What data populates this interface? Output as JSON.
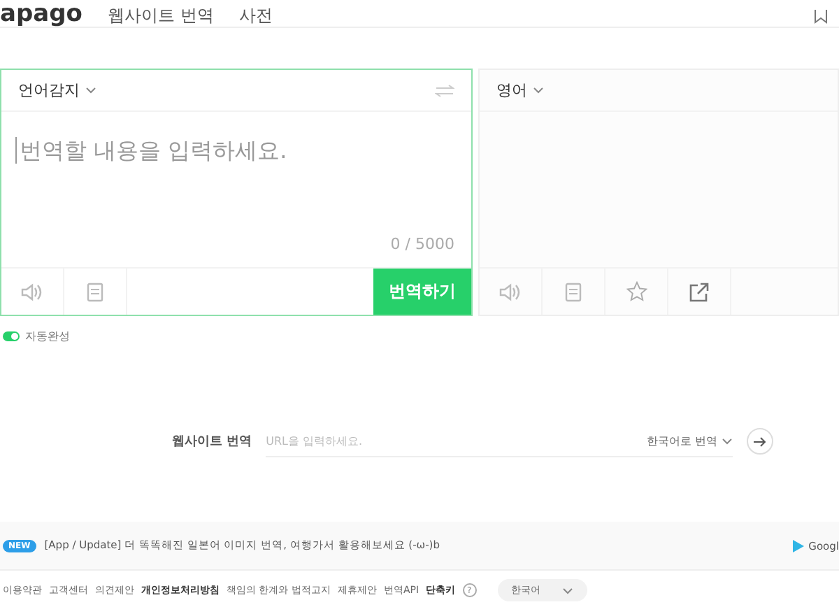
{
  "header": {
    "logo": "apago",
    "nav": [
      "웹사이트 번역",
      "사전"
    ]
  },
  "source": {
    "language": "언어감지",
    "placeholder": "번역할 내용을 입력하세요.",
    "counter": "0 / 5000",
    "button": "번역하기"
  },
  "target": {
    "language": "영어"
  },
  "autocomplete": {
    "label": "자동완성",
    "on": true
  },
  "website": {
    "label": "웹사이트 번역",
    "placeholder": "URL을 입력하세요.",
    "direction": "한국어로 번역"
  },
  "notice": {
    "badge": "NEW",
    "text": "[App / Update] 더 똑똑해진 일본어 이미지 번역, 여행가서 활용해보세요 (-ω-)b",
    "store": "Googl"
  },
  "footer": {
    "links": [
      {
        "label": "이용약관",
        "bold": false
      },
      {
        "label": "고객센터",
        "bold": false
      },
      {
        "label": "의견제안",
        "bold": false
      },
      {
        "label": "개인정보처리방침",
        "bold": true
      },
      {
        "label": "책임의 한계와 법적고지",
        "bold": false
      },
      {
        "label": "제휴제안",
        "bold": false
      },
      {
        "label": "번역API",
        "bold": false
      },
      {
        "label": "단축키",
        "bold": true
      }
    ],
    "help": "?",
    "language": "한국어"
  }
}
